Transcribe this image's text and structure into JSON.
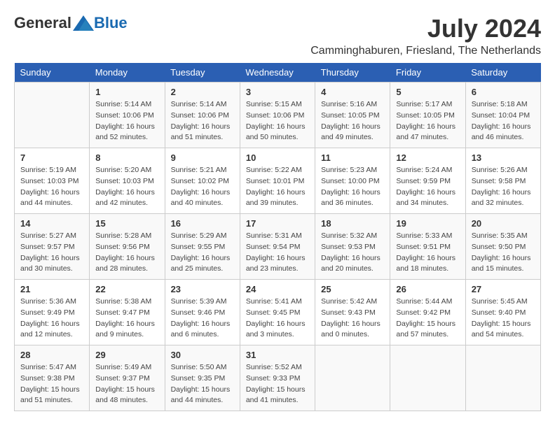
{
  "header": {
    "logo_general": "General",
    "logo_blue": "Blue",
    "month_year": "July 2024",
    "location": "Camminghaburen, Friesland, The Netherlands"
  },
  "columns": [
    "Sunday",
    "Monday",
    "Tuesday",
    "Wednesday",
    "Thursday",
    "Friday",
    "Saturday"
  ],
  "weeks": [
    [
      {
        "day": "",
        "info": ""
      },
      {
        "day": "1",
        "info": "Sunrise: 5:14 AM\nSunset: 10:06 PM\nDaylight: 16 hours\nand 52 minutes."
      },
      {
        "day": "2",
        "info": "Sunrise: 5:14 AM\nSunset: 10:06 PM\nDaylight: 16 hours\nand 51 minutes."
      },
      {
        "day": "3",
        "info": "Sunrise: 5:15 AM\nSunset: 10:06 PM\nDaylight: 16 hours\nand 50 minutes."
      },
      {
        "day": "4",
        "info": "Sunrise: 5:16 AM\nSunset: 10:05 PM\nDaylight: 16 hours\nand 49 minutes."
      },
      {
        "day": "5",
        "info": "Sunrise: 5:17 AM\nSunset: 10:05 PM\nDaylight: 16 hours\nand 47 minutes."
      },
      {
        "day": "6",
        "info": "Sunrise: 5:18 AM\nSunset: 10:04 PM\nDaylight: 16 hours\nand 46 minutes."
      }
    ],
    [
      {
        "day": "7",
        "info": "Sunrise: 5:19 AM\nSunset: 10:03 PM\nDaylight: 16 hours\nand 44 minutes."
      },
      {
        "day": "8",
        "info": "Sunrise: 5:20 AM\nSunset: 10:03 PM\nDaylight: 16 hours\nand 42 minutes."
      },
      {
        "day": "9",
        "info": "Sunrise: 5:21 AM\nSunset: 10:02 PM\nDaylight: 16 hours\nand 40 minutes."
      },
      {
        "day": "10",
        "info": "Sunrise: 5:22 AM\nSunset: 10:01 PM\nDaylight: 16 hours\nand 39 minutes."
      },
      {
        "day": "11",
        "info": "Sunrise: 5:23 AM\nSunset: 10:00 PM\nDaylight: 16 hours\nand 36 minutes."
      },
      {
        "day": "12",
        "info": "Sunrise: 5:24 AM\nSunset: 9:59 PM\nDaylight: 16 hours\nand 34 minutes."
      },
      {
        "day": "13",
        "info": "Sunrise: 5:26 AM\nSunset: 9:58 PM\nDaylight: 16 hours\nand 32 minutes."
      }
    ],
    [
      {
        "day": "14",
        "info": "Sunrise: 5:27 AM\nSunset: 9:57 PM\nDaylight: 16 hours\nand 30 minutes."
      },
      {
        "day": "15",
        "info": "Sunrise: 5:28 AM\nSunset: 9:56 PM\nDaylight: 16 hours\nand 28 minutes."
      },
      {
        "day": "16",
        "info": "Sunrise: 5:29 AM\nSunset: 9:55 PM\nDaylight: 16 hours\nand 25 minutes."
      },
      {
        "day": "17",
        "info": "Sunrise: 5:31 AM\nSunset: 9:54 PM\nDaylight: 16 hours\nand 23 minutes."
      },
      {
        "day": "18",
        "info": "Sunrise: 5:32 AM\nSunset: 9:53 PM\nDaylight: 16 hours\nand 20 minutes."
      },
      {
        "day": "19",
        "info": "Sunrise: 5:33 AM\nSunset: 9:51 PM\nDaylight: 16 hours\nand 18 minutes."
      },
      {
        "day": "20",
        "info": "Sunrise: 5:35 AM\nSunset: 9:50 PM\nDaylight: 16 hours\nand 15 minutes."
      }
    ],
    [
      {
        "day": "21",
        "info": "Sunrise: 5:36 AM\nSunset: 9:49 PM\nDaylight: 16 hours\nand 12 minutes."
      },
      {
        "day": "22",
        "info": "Sunrise: 5:38 AM\nSunset: 9:47 PM\nDaylight: 16 hours\nand 9 minutes."
      },
      {
        "day": "23",
        "info": "Sunrise: 5:39 AM\nSunset: 9:46 PM\nDaylight: 16 hours\nand 6 minutes."
      },
      {
        "day": "24",
        "info": "Sunrise: 5:41 AM\nSunset: 9:45 PM\nDaylight: 16 hours\nand 3 minutes."
      },
      {
        "day": "25",
        "info": "Sunrise: 5:42 AM\nSunset: 9:43 PM\nDaylight: 16 hours\nand 0 minutes."
      },
      {
        "day": "26",
        "info": "Sunrise: 5:44 AM\nSunset: 9:42 PM\nDaylight: 15 hours\nand 57 minutes."
      },
      {
        "day": "27",
        "info": "Sunrise: 5:45 AM\nSunset: 9:40 PM\nDaylight: 15 hours\nand 54 minutes."
      }
    ],
    [
      {
        "day": "28",
        "info": "Sunrise: 5:47 AM\nSunset: 9:38 PM\nDaylight: 15 hours\nand 51 minutes."
      },
      {
        "day": "29",
        "info": "Sunrise: 5:49 AM\nSunset: 9:37 PM\nDaylight: 15 hours\nand 48 minutes."
      },
      {
        "day": "30",
        "info": "Sunrise: 5:50 AM\nSunset: 9:35 PM\nDaylight: 15 hours\nand 44 minutes."
      },
      {
        "day": "31",
        "info": "Sunrise: 5:52 AM\nSunset: 9:33 PM\nDaylight: 15 hours\nand 41 minutes."
      },
      {
        "day": "",
        "info": ""
      },
      {
        "day": "",
        "info": ""
      },
      {
        "day": "",
        "info": ""
      }
    ]
  ]
}
